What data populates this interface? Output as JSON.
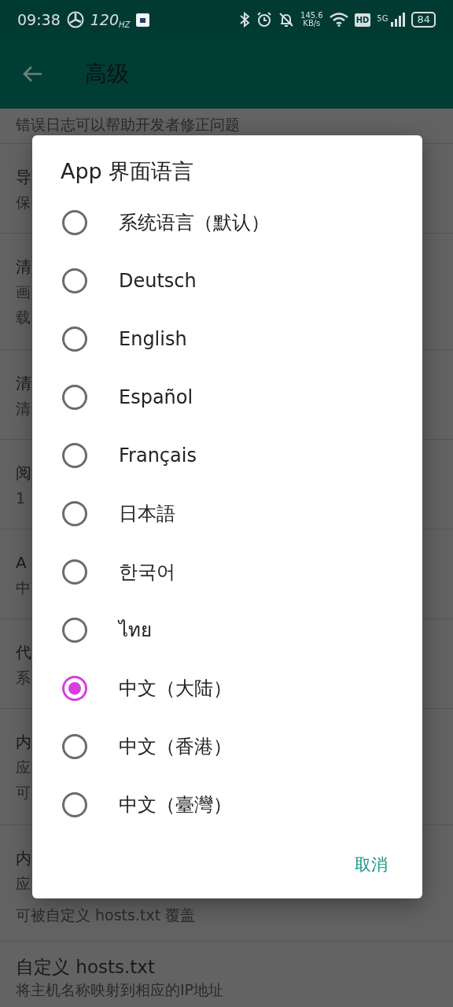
{
  "status_bar": {
    "time": "09:38",
    "refresh_rate": "120",
    "refresh_unit": "HZ",
    "network_speed": "145.6",
    "speed_unit": "KB/s",
    "hd": "HD",
    "network": "5G",
    "battery": "84"
  },
  "app_bar": {
    "title": "高级"
  },
  "settings": [
    {
      "lines": [
        "错误日志可以帮助开发者修正问题"
      ]
    },
    {
      "lines": [
        "导",
        "保"
      ]
    },
    {
      "lines": [
        "清",
        "画",
        "载"
      ]
    },
    {
      "lines": [
        "清",
        "清"
      ]
    },
    {
      "lines": [
        "阅",
        "1"
      ]
    },
    {
      "lines": [
        "A",
        "中"
      ]
    },
    {
      "lines": [
        "代",
        "系"
      ]
    },
    {
      "lines": [
        "内",
        "应",
        "可"
      ]
    },
    {
      "lines": [
        "内",
        "应",
        "可被自定义 hosts.txt 覆盖"
      ]
    },
    {
      "lines": [
        "自定义 hosts.txt",
        "将主机名称映射到相应的IP地址"
      ]
    }
  ],
  "dialog": {
    "title": "App 界面语言",
    "options": [
      {
        "label": "系统语言（默认）",
        "selected": false
      },
      {
        "label": "Deutsch",
        "selected": false
      },
      {
        "label": "English",
        "selected": false
      },
      {
        "label": "Español",
        "selected": false
      },
      {
        "label": "Français",
        "selected": false
      },
      {
        "label": "日本語",
        "selected": false
      },
      {
        "label": "한국어",
        "selected": false
      },
      {
        "label": "ไทย",
        "selected": false
      },
      {
        "label": "中文（大陆）",
        "selected": true
      },
      {
        "label": "中文（香港）",
        "selected": false
      },
      {
        "label": "中文（臺灣）",
        "selected": false
      }
    ],
    "buttons": [
      "取消"
    ]
  }
}
